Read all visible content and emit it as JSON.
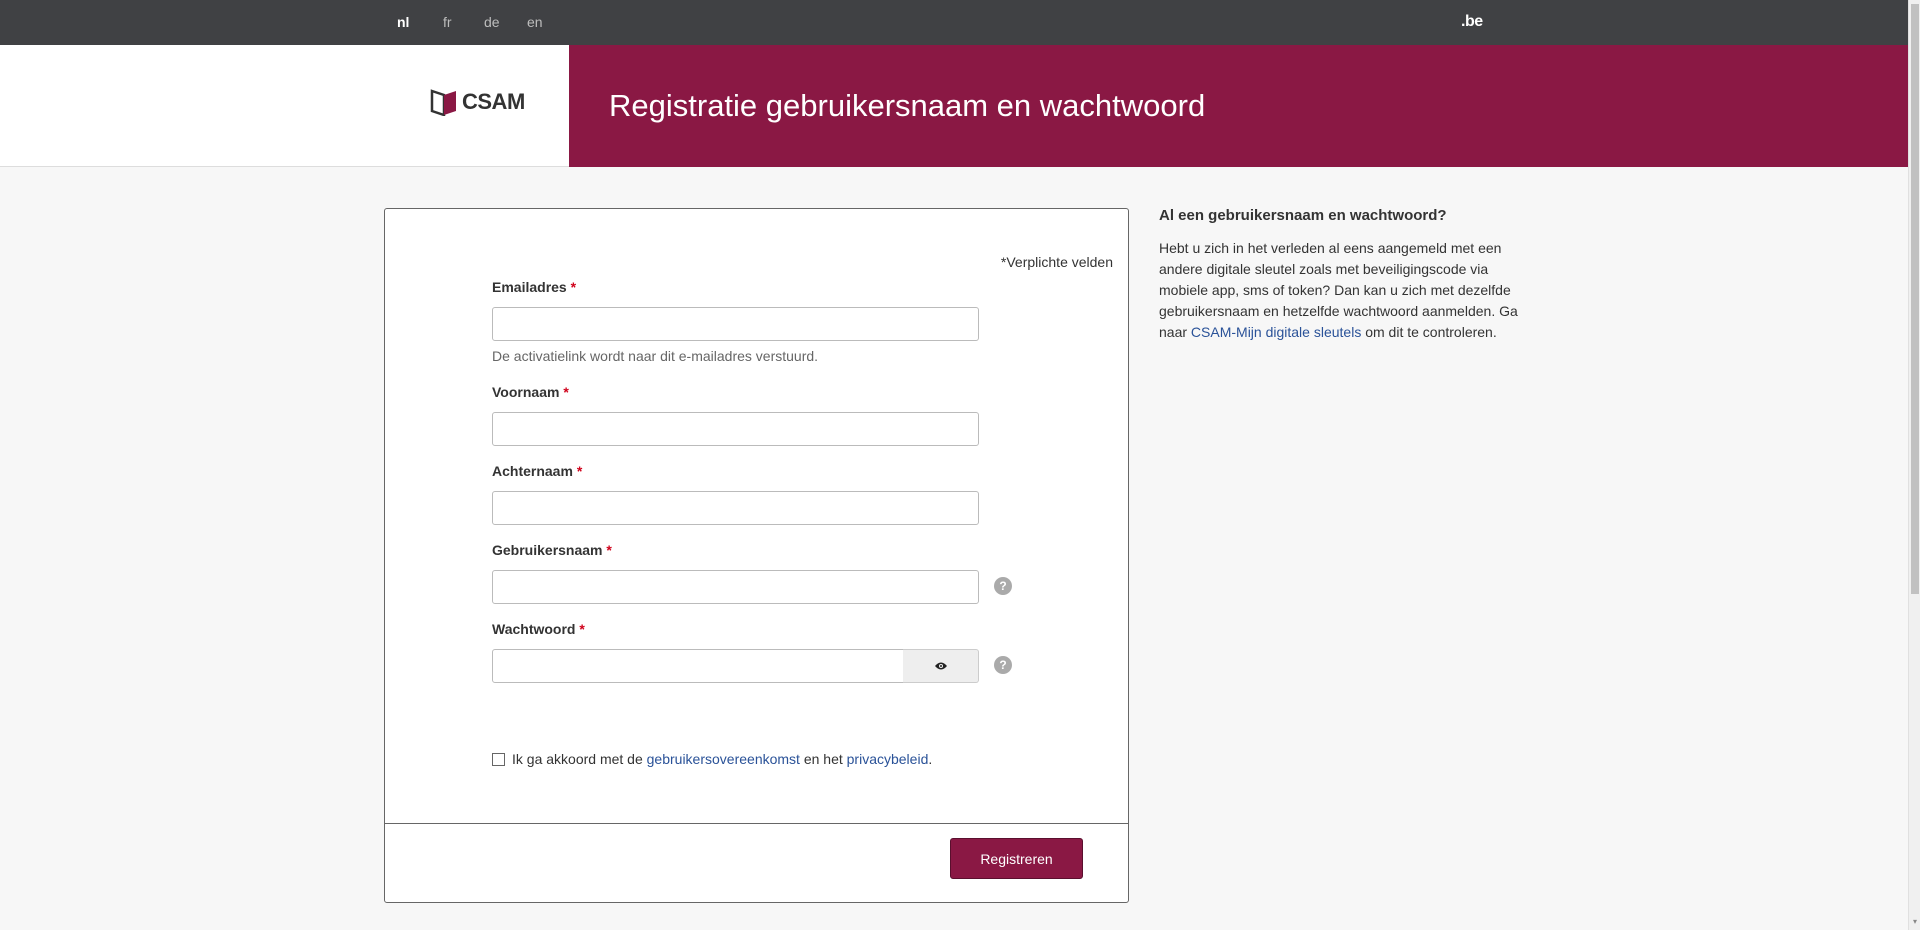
{
  "topbar": {
    "languages": [
      "nl",
      "fr",
      "de",
      "en"
    ],
    "active_language": "nl",
    "be_logo": ".be"
  },
  "header": {
    "logo_text": "CSAM",
    "title": "Registratie gebruikersnaam en wachtwoord"
  },
  "form": {
    "required_note": "*Verplichte velden",
    "required_marker": "*",
    "email": {
      "label": "Emailadres",
      "value": "",
      "help": "De activatielink wordt naar dit e-mailadres verstuurd."
    },
    "firstname": {
      "label": "Voornaam",
      "value": ""
    },
    "lastname": {
      "label": "Achternaam",
      "value": ""
    },
    "username": {
      "label": "Gebruikersnaam",
      "value": ""
    },
    "password": {
      "label": "Wachtwoord",
      "value": ""
    },
    "help_icon": "?",
    "consent": {
      "prefix": "Ik ga akkoord met de ",
      "terms_link": "gebruikersovereenkomst",
      "middle": " en het ",
      "privacy_link": "privacybeleid",
      "suffix": "."
    },
    "submit_label": "Registreren"
  },
  "sidebar": {
    "heading": "Al een gebruikersnaam en wachtwoord?",
    "text": "Hebt u zich in het verleden al eens aangemeld met een andere digitale sleutel zoals met beveiligingscode via mobiele app, sms of token? Dan kan u zich met dezelfde gebruikersnaam en hetzelfde wachtwoord aanmelden. Ga naar ",
    "link": "CSAM-Mijn digitale sleutels",
    "text_after": " om dit te controleren."
  },
  "colors": {
    "brand": "#8a1844",
    "topbar": "#404144",
    "link": "#2a5298"
  }
}
